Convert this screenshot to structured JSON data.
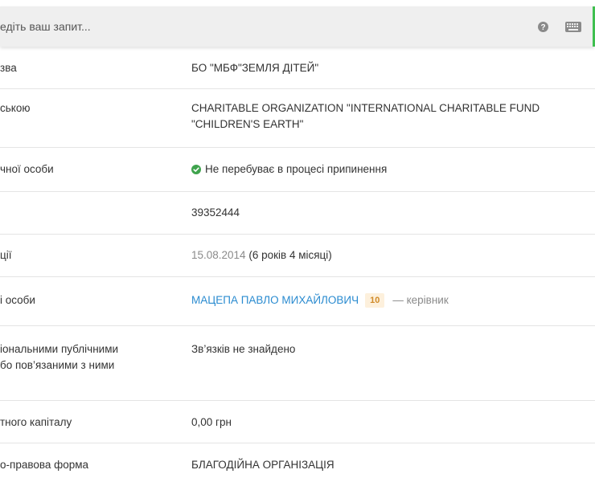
{
  "search": {
    "placeholder": "едіть ваш запит..."
  },
  "colors": {
    "accent": "#3fbf4f",
    "status_ok": "#3fa34d",
    "link": "#2a8bd0",
    "badge_text": "#d08a28",
    "badge_bg": "#fdf0dc"
  },
  "icons": {
    "help": "question-circle-icon",
    "keyboard": "keyboard-icon",
    "status": "check-circle-icon"
  },
  "rows": [
    {
      "label": "зва",
      "value": "БО \"МБФ\"ЗЕМЛЯ ДІТЕЙ\""
    },
    {
      "label": "ською",
      "value_line1": "CHARITABLE ORGANIZATION \"INTERNATIONAL CHARITABLE FUND",
      "value_line2": "\"CHILDREN'S EARTH\""
    },
    {
      "label": "чної особи",
      "value": "Не перебуває в процесі припинення"
    },
    {
      "label": "",
      "value": "39352444"
    },
    {
      "label": "ції",
      "date": "15.08.2014",
      "age": "(6 років 4 місяці)"
    },
    {
      "label": "і особи",
      "name": "МАЦЕПА ПАВЛО МИХАЙЛОВИЧ",
      "badge": "10",
      "role": "— керівник"
    },
    {
      "label_line1": "іональними публічними",
      "label_line2": "бо пов’язаними з ними",
      "value": "Зв’язків не знайдено"
    },
    {
      "label": "тного капіталу",
      "value": "0,00 грн"
    },
    {
      "label": "о-правова форма",
      "value": "БЛАГОДІЙНА ОРГАНІЗАЦІЯ"
    }
  ]
}
